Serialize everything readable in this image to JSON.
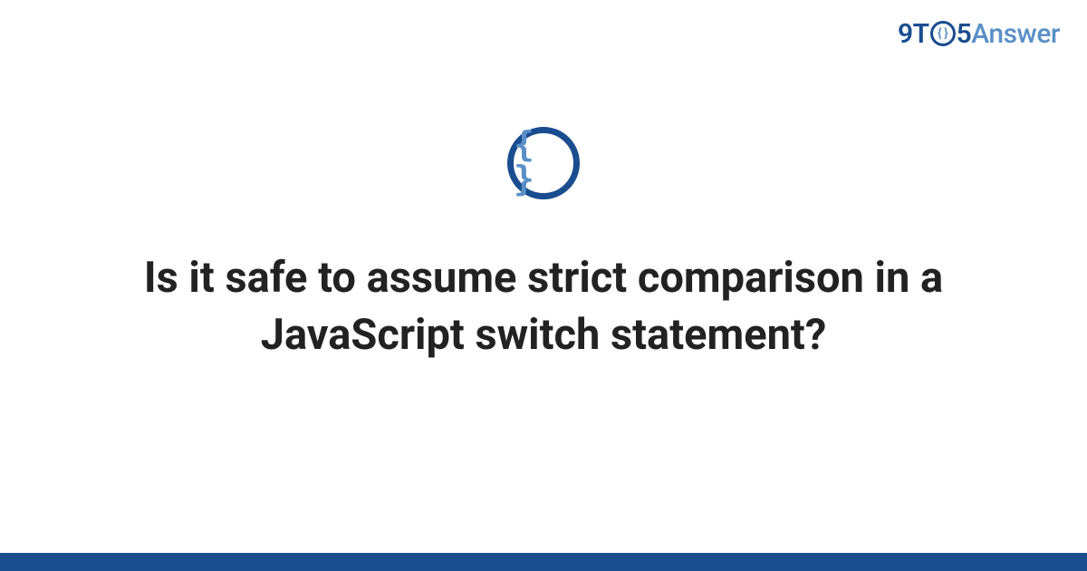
{
  "brand": {
    "part1": "9T",
    "circle_inner": "{ }",
    "part2": "5",
    "part3": "Answer"
  },
  "topic_icon": {
    "symbol": "{ }",
    "name": "code-braces-icon"
  },
  "question": {
    "title": "Is it safe to assume strict comparison in a JavaScript switch statement?"
  },
  "colors": {
    "brand_dark": "#1a4d8f",
    "brand_light": "#5a8fc7",
    "text": "#222222"
  }
}
